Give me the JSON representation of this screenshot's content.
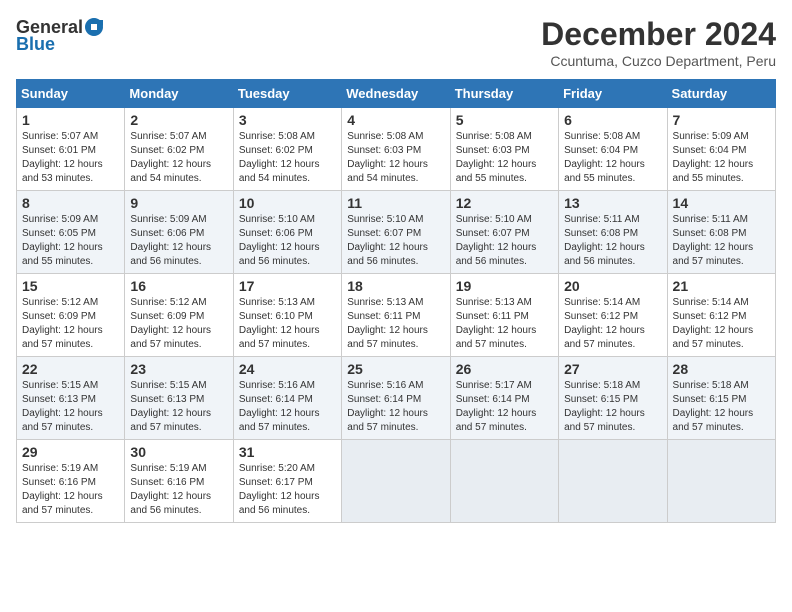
{
  "header": {
    "logo_general": "General",
    "logo_blue": "Blue",
    "month_title": "December 2024",
    "location": "Ccuntuma, Cuzco Department, Peru"
  },
  "calendar": {
    "days_of_week": [
      "Sunday",
      "Monday",
      "Tuesday",
      "Wednesday",
      "Thursday",
      "Friday",
      "Saturday"
    ],
    "weeks": [
      [
        {
          "day": "1",
          "sunrise": "5:07 AM",
          "sunset": "6:01 PM",
          "daylight": "12 hours and 53 minutes."
        },
        {
          "day": "2",
          "sunrise": "5:07 AM",
          "sunset": "6:02 PM",
          "daylight": "12 hours and 54 minutes."
        },
        {
          "day": "3",
          "sunrise": "5:08 AM",
          "sunset": "6:02 PM",
          "daylight": "12 hours and 54 minutes."
        },
        {
          "day": "4",
          "sunrise": "5:08 AM",
          "sunset": "6:03 PM",
          "daylight": "12 hours and 54 minutes."
        },
        {
          "day": "5",
          "sunrise": "5:08 AM",
          "sunset": "6:03 PM",
          "daylight": "12 hours and 55 minutes."
        },
        {
          "day": "6",
          "sunrise": "5:08 AM",
          "sunset": "6:04 PM",
          "daylight": "12 hours and 55 minutes."
        },
        {
          "day": "7",
          "sunrise": "5:09 AM",
          "sunset": "6:04 PM",
          "daylight": "12 hours and 55 minutes."
        }
      ],
      [
        {
          "day": "8",
          "sunrise": "5:09 AM",
          "sunset": "6:05 PM",
          "daylight": "12 hours and 55 minutes."
        },
        {
          "day": "9",
          "sunrise": "5:09 AM",
          "sunset": "6:06 PM",
          "daylight": "12 hours and 56 minutes."
        },
        {
          "day": "10",
          "sunrise": "5:10 AM",
          "sunset": "6:06 PM",
          "daylight": "12 hours and 56 minutes."
        },
        {
          "day": "11",
          "sunrise": "5:10 AM",
          "sunset": "6:07 PM",
          "daylight": "12 hours and 56 minutes."
        },
        {
          "day": "12",
          "sunrise": "5:10 AM",
          "sunset": "6:07 PM",
          "daylight": "12 hours and 56 minutes."
        },
        {
          "day": "13",
          "sunrise": "5:11 AM",
          "sunset": "6:08 PM",
          "daylight": "12 hours and 56 minutes."
        },
        {
          "day": "14",
          "sunrise": "5:11 AM",
          "sunset": "6:08 PM",
          "daylight": "12 hours and 57 minutes."
        }
      ],
      [
        {
          "day": "15",
          "sunrise": "5:12 AM",
          "sunset": "6:09 PM",
          "daylight": "12 hours and 57 minutes."
        },
        {
          "day": "16",
          "sunrise": "5:12 AM",
          "sunset": "6:09 PM",
          "daylight": "12 hours and 57 minutes."
        },
        {
          "day": "17",
          "sunrise": "5:13 AM",
          "sunset": "6:10 PM",
          "daylight": "12 hours and 57 minutes."
        },
        {
          "day": "18",
          "sunrise": "5:13 AM",
          "sunset": "6:11 PM",
          "daylight": "12 hours and 57 minutes."
        },
        {
          "day": "19",
          "sunrise": "5:13 AM",
          "sunset": "6:11 PM",
          "daylight": "12 hours and 57 minutes."
        },
        {
          "day": "20",
          "sunrise": "5:14 AM",
          "sunset": "6:12 PM",
          "daylight": "12 hours and 57 minutes."
        },
        {
          "day": "21",
          "sunrise": "5:14 AM",
          "sunset": "6:12 PM",
          "daylight": "12 hours and 57 minutes."
        }
      ],
      [
        {
          "day": "22",
          "sunrise": "5:15 AM",
          "sunset": "6:13 PM",
          "daylight": "12 hours and 57 minutes."
        },
        {
          "day": "23",
          "sunrise": "5:15 AM",
          "sunset": "6:13 PM",
          "daylight": "12 hours and 57 minutes."
        },
        {
          "day": "24",
          "sunrise": "5:16 AM",
          "sunset": "6:14 PM",
          "daylight": "12 hours and 57 minutes."
        },
        {
          "day": "25",
          "sunrise": "5:16 AM",
          "sunset": "6:14 PM",
          "daylight": "12 hours and 57 minutes."
        },
        {
          "day": "26",
          "sunrise": "5:17 AM",
          "sunset": "6:14 PM",
          "daylight": "12 hours and 57 minutes."
        },
        {
          "day": "27",
          "sunrise": "5:18 AM",
          "sunset": "6:15 PM",
          "daylight": "12 hours and 57 minutes."
        },
        {
          "day": "28",
          "sunrise": "5:18 AM",
          "sunset": "6:15 PM",
          "daylight": "12 hours and 57 minutes."
        }
      ],
      [
        {
          "day": "29",
          "sunrise": "5:19 AM",
          "sunset": "6:16 PM",
          "daylight": "12 hours and 57 minutes."
        },
        {
          "day": "30",
          "sunrise": "5:19 AM",
          "sunset": "6:16 PM",
          "daylight": "12 hours and 56 minutes."
        },
        {
          "day": "31",
          "sunrise": "5:20 AM",
          "sunset": "6:17 PM",
          "daylight": "12 hours and 56 minutes."
        },
        null,
        null,
        null,
        null
      ]
    ]
  }
}
